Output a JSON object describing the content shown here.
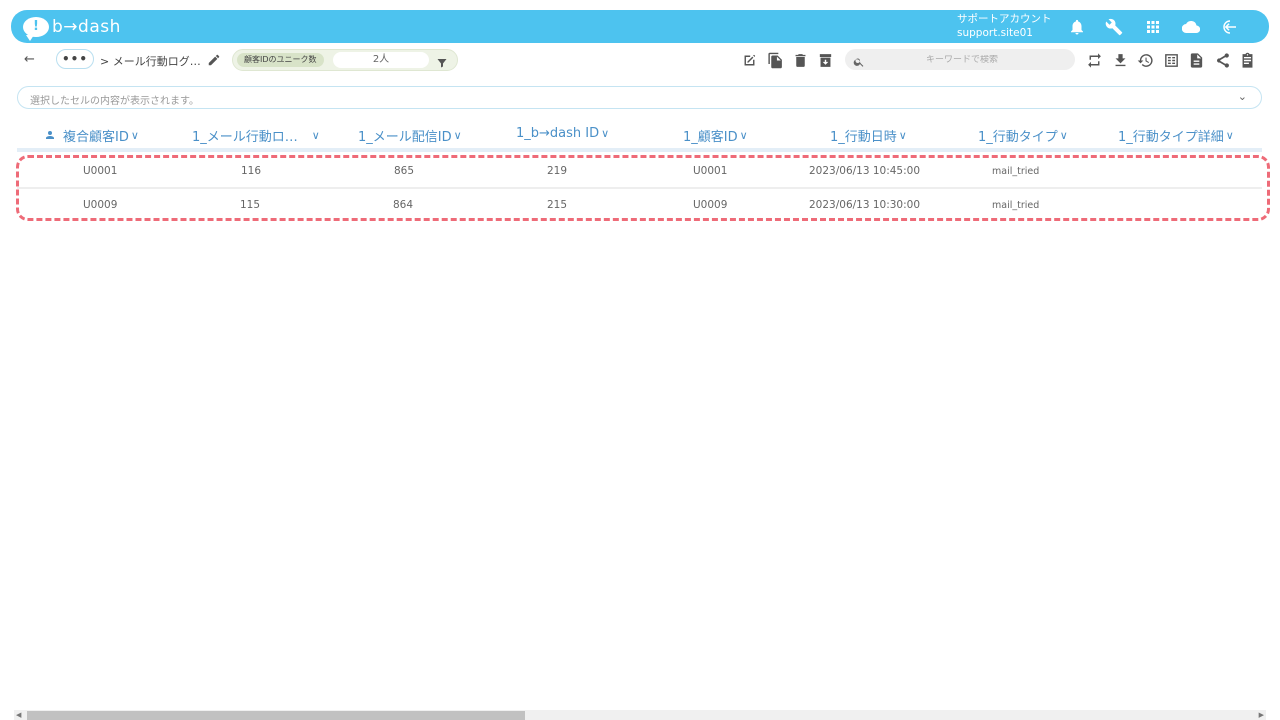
{
  "app": {
    "logo_mark": "!",
    "logo_text": "b→dash",
    "account_line1": "サポートアカウント",
    "account_line2": "support.site01",
    "top_icons": [
      "bell-icon",
      "wrench-icon",
      "apps-grid-icon",
      "cloud-icon",
      "logout-icon"
    ]
  },
  "toolbar": {
    "back_label": "←",
    "more_label": "•••",
    "breadcrumb": "> メール行動ログ…",
    "unique_label": "顧客IDのユニーク数",
    "unique_value": "2人",
    "tool_icons_left": [
      "edit-icon",
      "copy-icon",
      "delete-icon",
      "archive-icon"
    ],
    "search_placeholder": "キーワードで検索",
    "tool_icons_right": [
      "swap-icon",
      "download-icon",
      "history-icon",
      "table-icon",
      "document-icon",
      "share-icon",
      "clipboard-icon"
    ]
  },
  "cell_bar": {
    "text": "選択したセルの内容が表示されます。",
    "chevron": "⌄"
  },
  "table": {
    "columns": [
      "複合顧客ID",
      "1_メール行動ロ…",
      "1_メール配信ID",
      "1_b→dash ID",
      "1_顧客ID",
      "1_行動日時",
      "1_行動タイプ",
      "1_行動タイプ詳細"
    ],
    "rows": [
      [
        "U0001",
        "116",
        "865",
        "219",
        "U0001",
        "2023/06/13 10:45:00",
        "mail_tried",
        ""
      ],
      [
        "U0009",
        "115",
        "864",
        "215",
        "U0009",
        "2023/06/13 10:30:00",
        "mail_tried",
        ""
      ]
    ]
  },
  "colors": {
    "header_bg": "#4dc3ef",
    "column_header_text": "#4a90c8",
    "highlight_border": "#ee6b78"
  }
}
